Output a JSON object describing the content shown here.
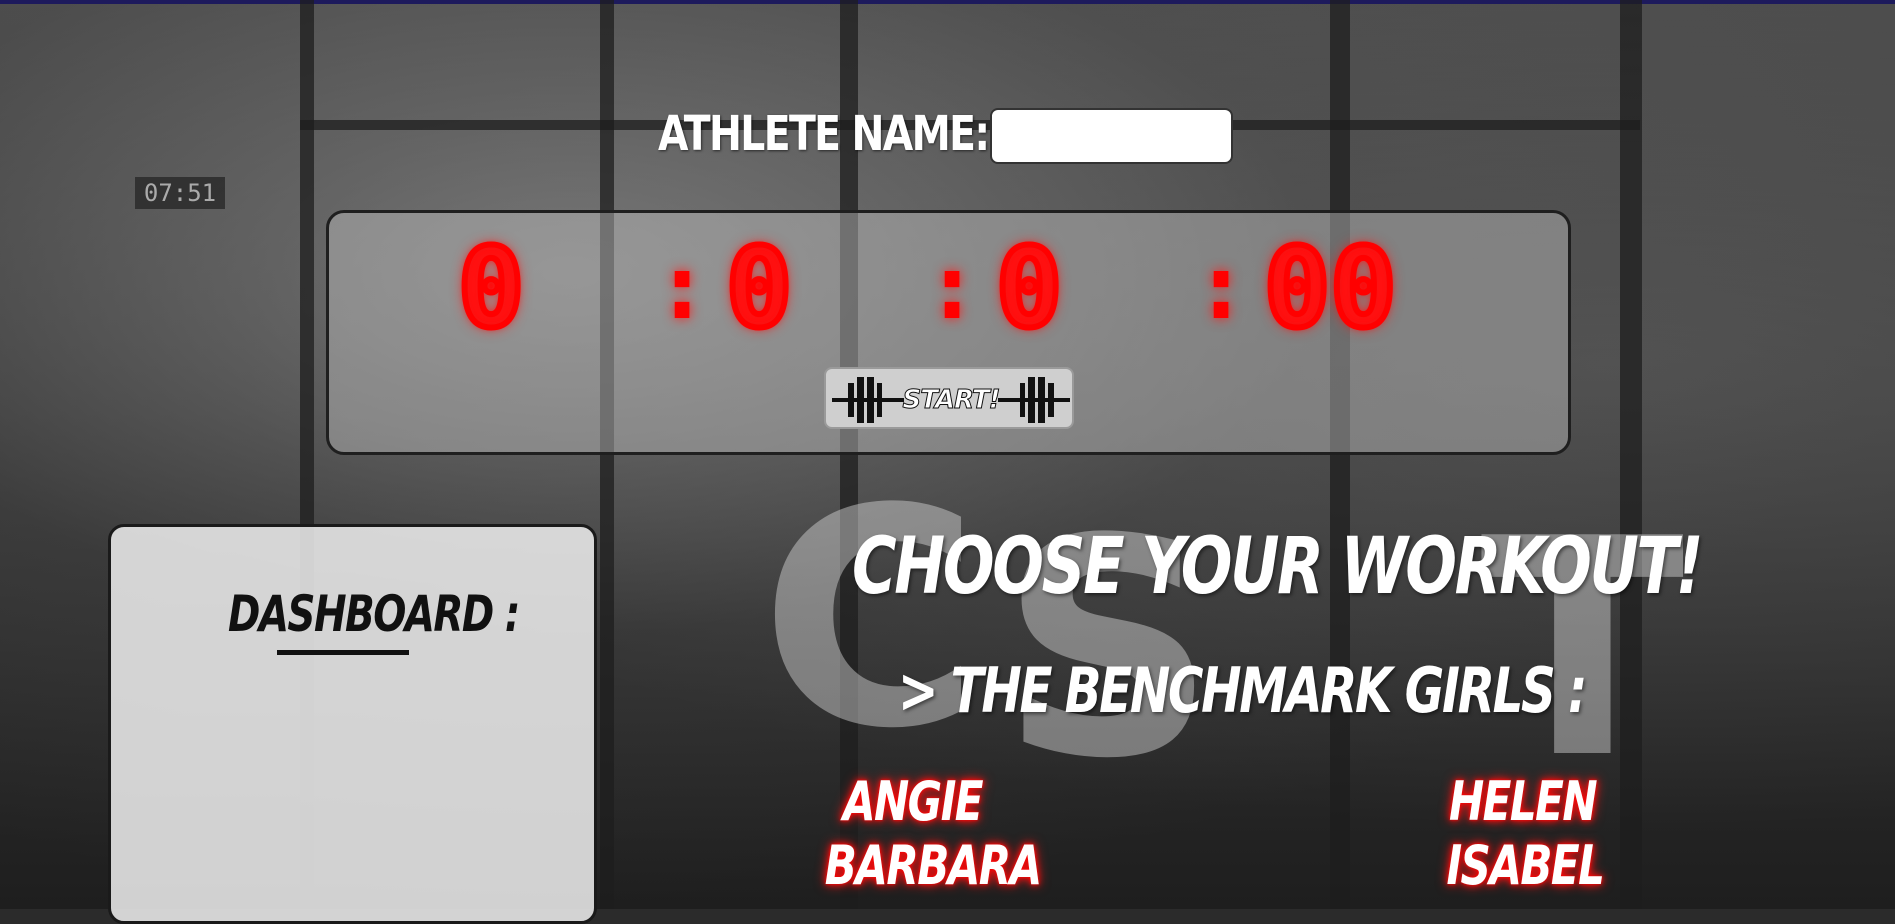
{
  "athlete": {
    "label": "ATHLETE NAME:",
    "input_value": "",
    "input_placeholder": ""
  },
  "timer": {
    "hours": "0",
    "minutes": "0",
    "seconds": "0",
    "centiseconds": "00",
    "separator": ":",
    "digit_color": "#ff0000"
  },
  "controls": {
    "start_label": "START!"
  },
  "dashboard": {
    "title": "DASHBOARD :"
  },
  "workouts": {
    "heading": "CHOOSE YOUR WORKOUT!",
    "subheading": "> THE BENCHMARK GIRLS :",
    "left_column": [
      "ANGIE",
      "BARBARA"
    ],
    "right_column": [
      "HELEN",
      "ISABEL"
    ],
    "glow_color": "#ff0000"
  },
  "background": {
    "clock_text": "07:51",
    "wall_text": "CROSSFIT"
  },
  "colors": {
    "topbar": "#1d1a5c",
    "panel_border": "#1f1f1f"
  }
}
